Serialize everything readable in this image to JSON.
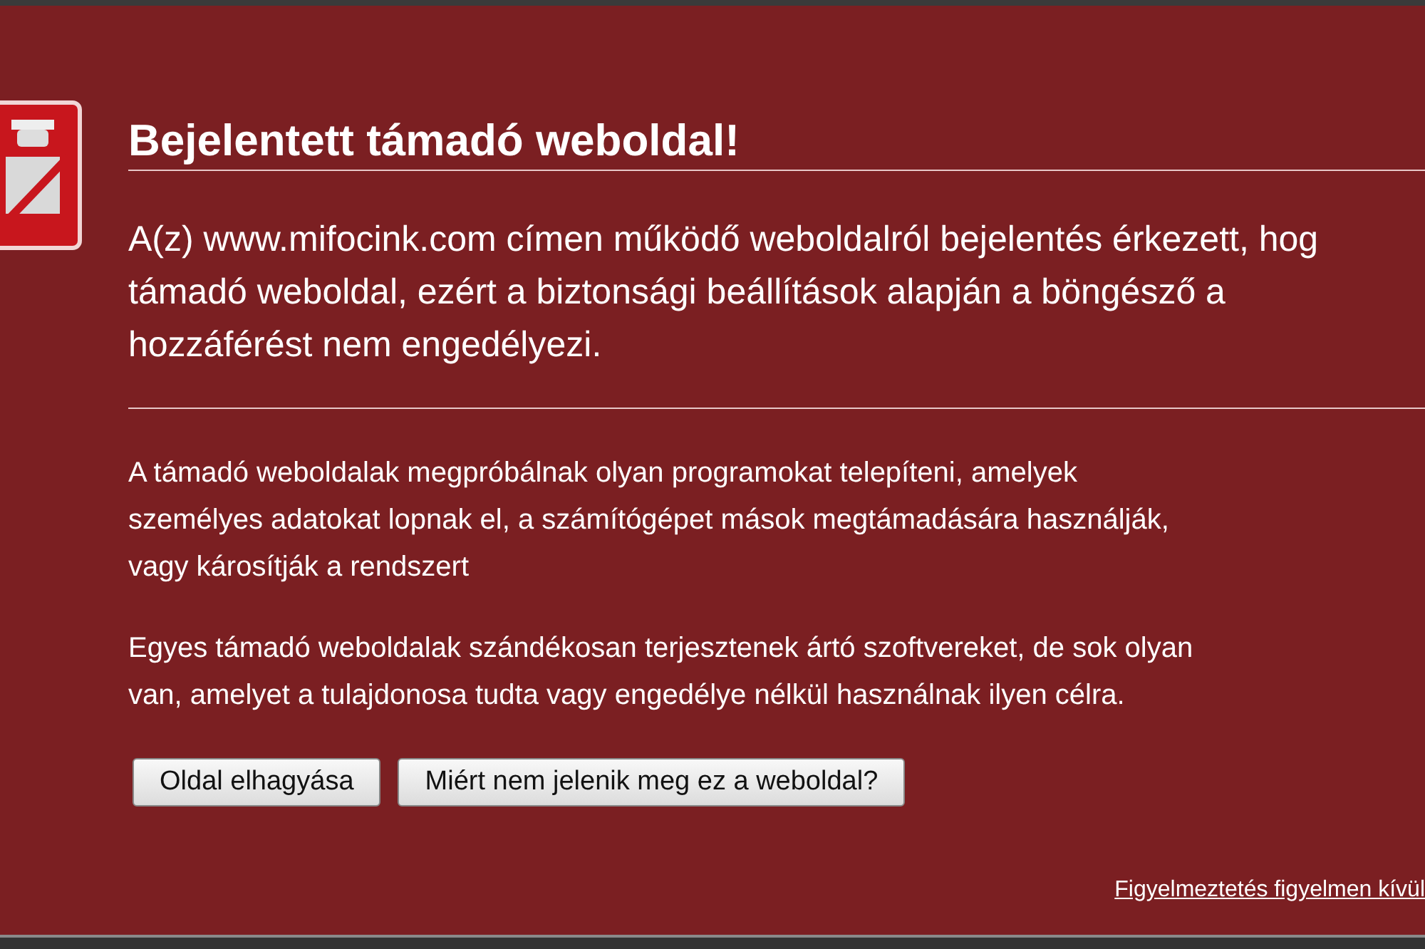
{
  "title": "Bejelentett támadó weboldal!",
  "intro_lines": [
    "A(z) www.mifocink.com címen működő weboldalról bejelentés érkezett, hog",
    "támadó weboldal, ezért a biztonsági beállítások alapján a böngésző a",
    "hozzáférést nem engedélyezi."
  ],
  "paragraphs": [
    [
      "A támadó weboldalak megpróbálnak olyan programokat telepíteni, amelyek",
      "személyes adatokat lopnak el, a számítógépet mások megtámadására használják,",
      "vagy károsítják a rendszert"
    ],
    [
      "Egyes támadó weboldalak szándékosan terjesztenek ártó szoftvereket, de sok olyan",
      "van, amelyet a tulajdonosa tudta vagy engedélye nélkül használnak ilyen célra."
    ]
  ],
  "buttons": [
    "Oldal elhagyása",
    "Miért nem jelenik meg ez a weboldal?"
  ],
  "ignore_link": "Figyelmeztetés figyelmen kívül"
}
